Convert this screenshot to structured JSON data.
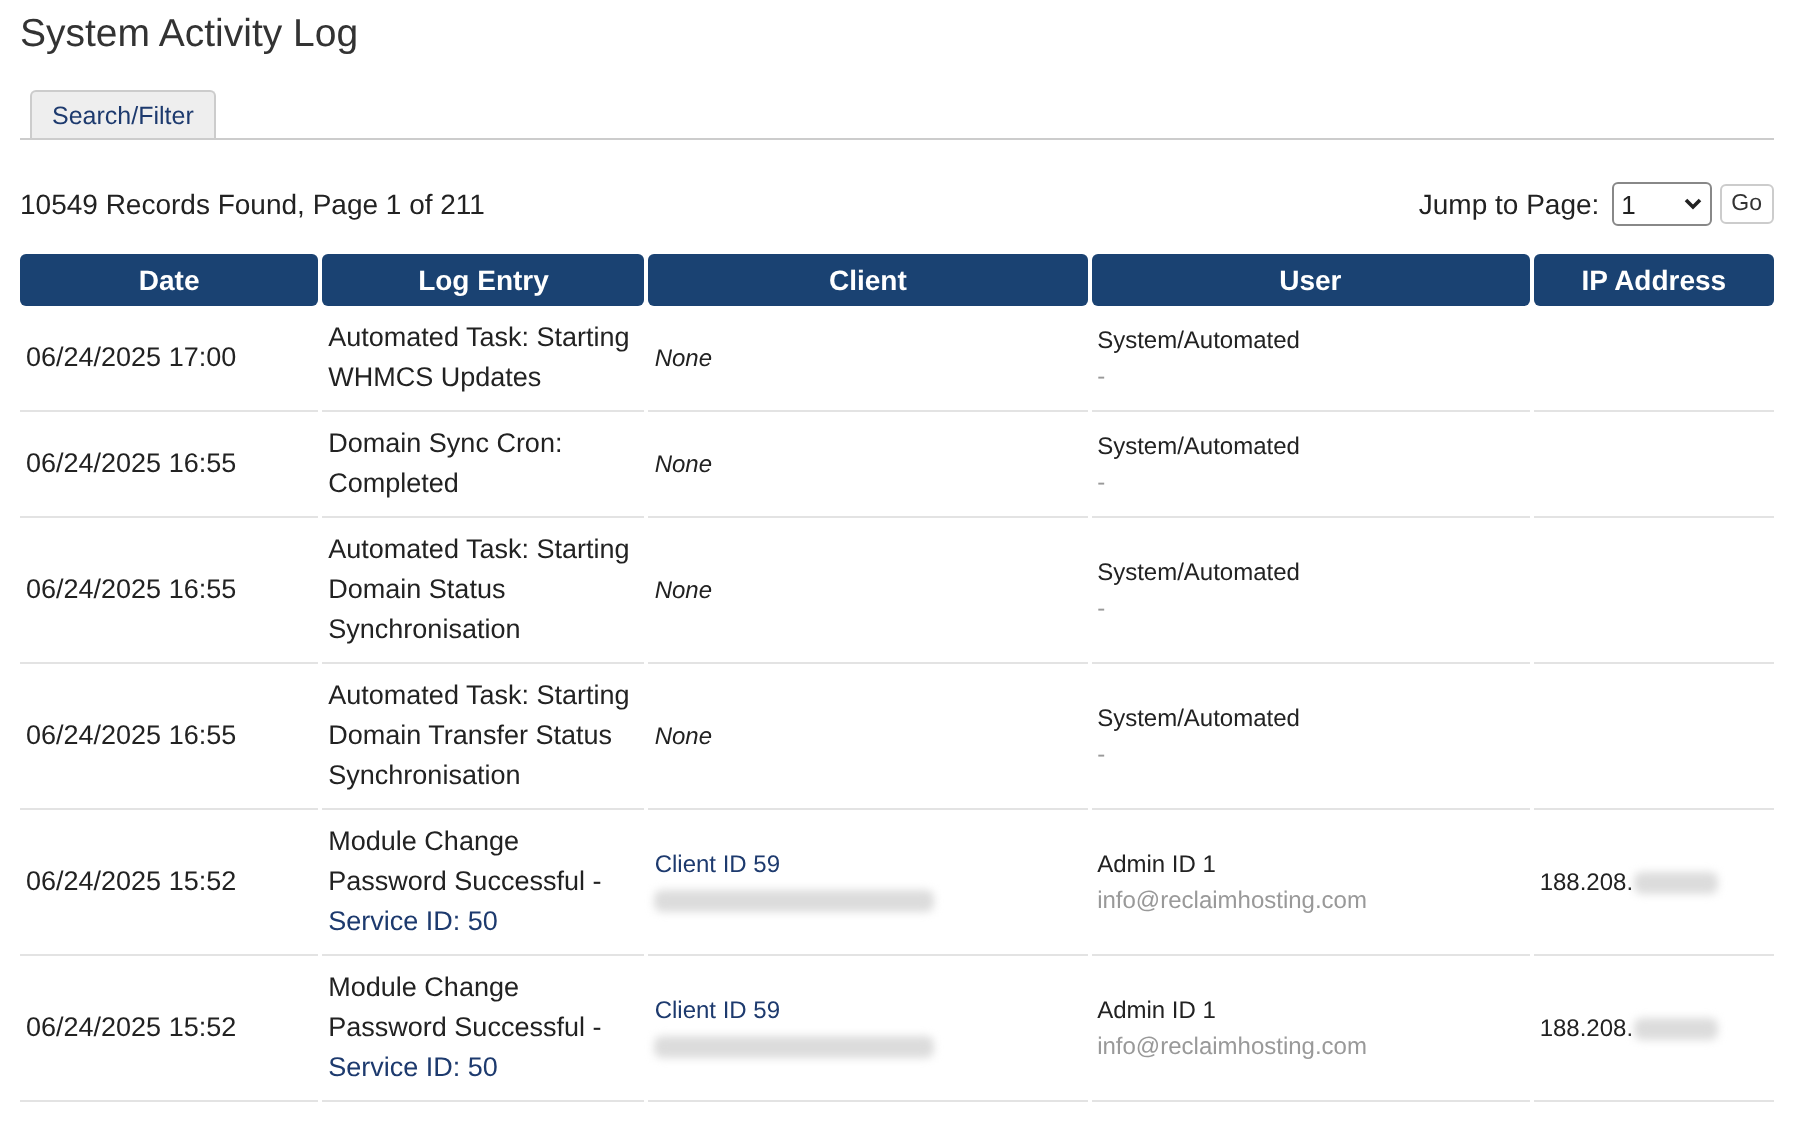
{
  "title": "System Activity Log",
  "tabs": [
    {
      "label": "Search/Filter",
      "selected": false
    }
  ],
  "summary": "10549 Records Found, Page 1 of 211",
  "jump": {
    "label": "Jump to Page:",
    "value": "1",
    "button": "Go"
  },
  "table": {
    "columns": [
      "Date",
      "Log Entry",
      "Client",
      "User",
      "IP Address"
    ],
    "rows": [
      {
        "date": "06/24/2025 17:00",
        "entry": "Automated Task: Starting WHMCS Updates",
        "client": {
          "kind": "none",
          "text": "None"
        },
        "user": {
          "name": "System/Automated",
          "sub": "-"
        }
      },
      {
        "date": "06/24/2025 16:55",
        "entry": "Domain Sync Cron: Completed",
        "client": {
          "kind": "none",
          "text": "None"
        },
        "user": {
          "name": "System/Automated",
          "sub": "-"
        }
      },
      {
        "date": "06/24/2025 16:55",
        "entry": "Automated Task: Starting Domain Status Synchronisation",
        "client": {
          "kind": "none",
          "text": "None"
        },
        "user": {
          "name": "System/Automated",
          "sub": "-"
        }
      },
      {
        "date": "06/24/2025 16:55",
        "entry": "Automated Task: Starting Domain Transfer Status Synchronisation",
        "client": {
          "kind": "none",
          "text": "None"
        },
        "user": {
          "name": "System/Automated",
          "sub": "-"
        }
      },
      {
        "date": "06/24/2025 15:52",
        "entry": "Module Change Password Successful -",
        "entry_link": "Service ID: 50",
        "client": {
          "kind": "link",
          "text": "Client ID 59"
        },
        "user": {
          "name": "Admin ID 1",
          "sub": "info@reclaimhosting.com"
        },
        "ip": "188.208."
      },
      {
        "date": "06/24/2025 15:52",
        "entry": "Module Change Password Successful -",
        "entry_link": "Service ID: 50",
        "client": {
          "kind": "link",
          "text": "Client ID 59"
        },
        "user": {
          "name": "Admin ID 1",
          "sub": "info@reclaimhosting.com"
        },
        "ip": "188.208."
      }
    ]
  }
}
